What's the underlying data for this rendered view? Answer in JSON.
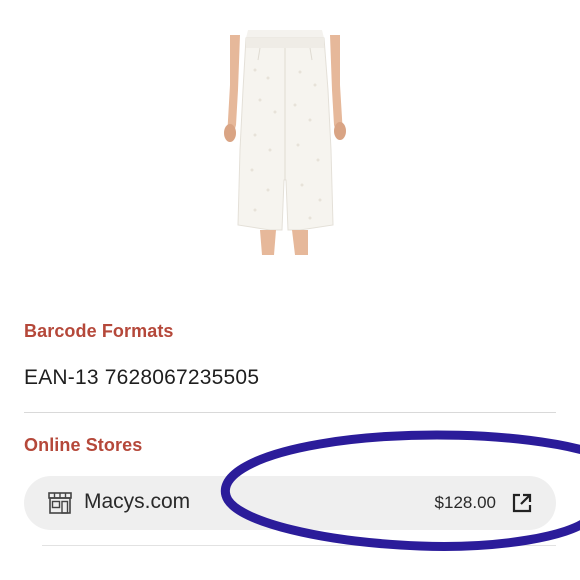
{
  "product": {
    "image_icon": "pencil-skirt-photo"
  },
  "barcode": {
    "heading": "Barcode Formats",
    "value": "EAN-13 7628067235505"
  },
  "stores": {
    "heading": "Online Stores",
    "items": [
      {
        "name": "Macys.com",
        "price": "$128.00",
        "icon": "storefront-icon",
        "action_icon": "external-link-icon"
      }
    ]
  },
  "colors": {
    "accent": "#b5483a",
    "row_background": "#efefef",
    "annotation": "#2b1c9a"
  }
}
